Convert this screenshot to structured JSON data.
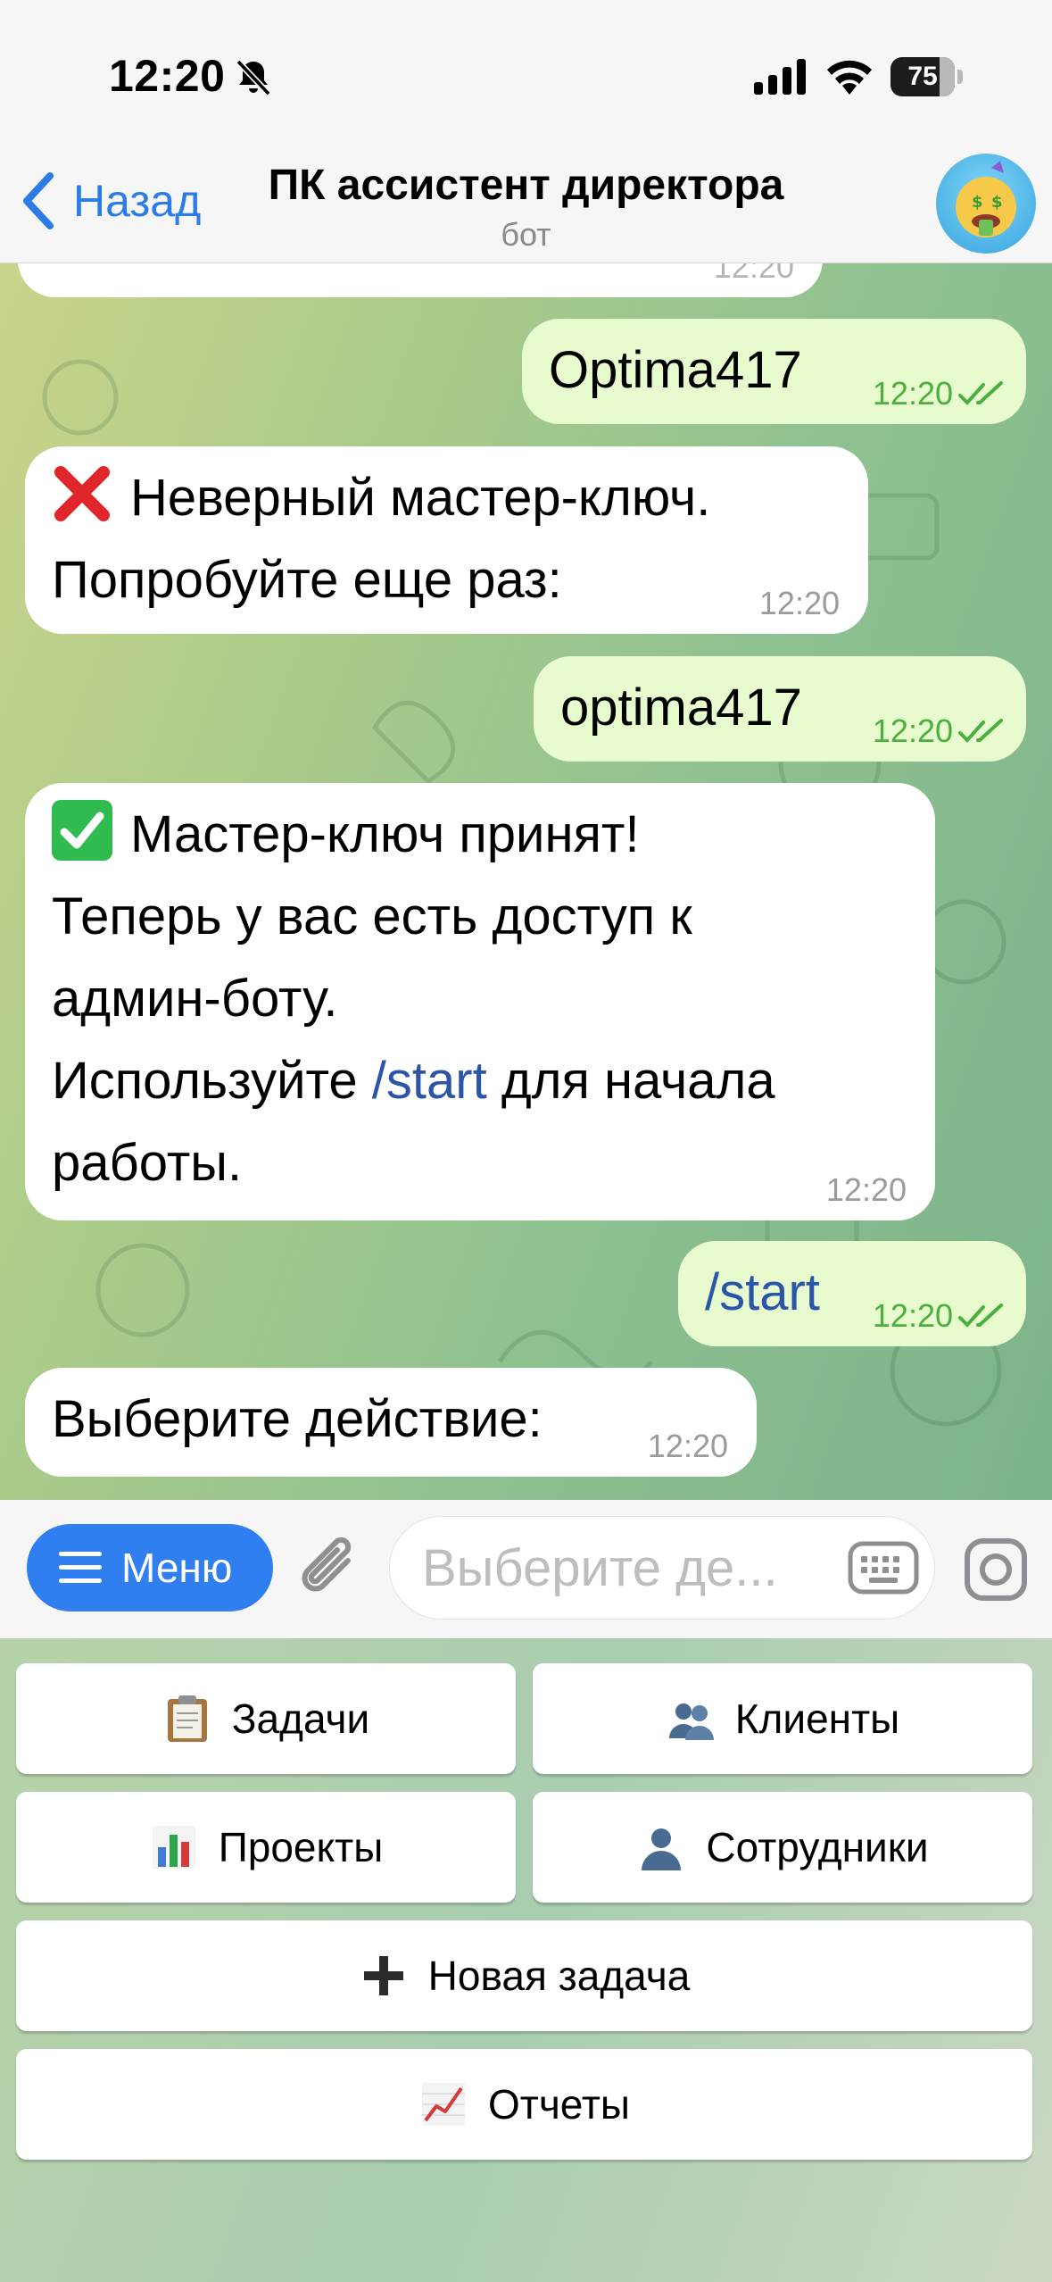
{
  "status_bar": {
    "time": "12:20",
    "battery": "75",
    "icons": [
      "bell-slash-icon",
      "cellular-signal-icon",
      "wifi-icon",
      "battery-icon"
    ]
  },
  "header": {
    "back_label": "Назад",
    "title": "ПК ассистент директора",
    "subtitle": "бот",
    "avatar_icon": "money-mouth-face-icon"
  },
  "chat": {
    "messages": [
      {
        "direction": "out",
        "text": "Optima417",
        "time": "12:20",
        "read": true
      },
      {
        "direction": "in",
        "icon": "red-cross-mark-icon",
        "lines": [
          "Неверный мастер-ключ.",
          "Попробуйте еще раз:"
        ],
        "time": "12:20"
      },
      {
        "direction": "out",
        "text": "optima417",
        "time": "12:20",
        "read": true
      },
      {
        "direction": "in",
        "icon": "green-check-mark-icon",
        "lines": [
          "Мастер-ключ принят!",
          "Теперь у вас есть доступ к",
          "админ-боту.",
          "Используйте",
          "/start",
          "для начала",
          "работы."
        ],
        "time": "12:20"
      },
      {
        "direction": "out",
        "text": "/start",
        "time": "12:20",
        "read": true
      },
      {
        "direction": "in",
        "text": "Выберите действие:",
        "time": "12:20"
      }
    ]
  },
  "input_bar": {
    "menu_label": "Меню",
    "placeholder": "Выберите де..."
  },
  "bot_keyboard": {
    "buttons": [
      {
        "label": "Задачи",
        "icon": "clipboard-icon"
      },
      {
        "label": "Клиенты",
        "icon": "busts-in-silhouette-icon"
      },
      {
        "label": "Проекты",
        "icon": "bar-chart-icon"
      },
      {
        "label": "Сотрудники",
        "icon": "bust-in-silhouette-icon"
      },
      {
        "label": "Новая задача",
        "icon": "plus-icon"
      },
      {
        "label": "Отчеты",
        "icon": "chart-increasing-icon"
      }
    ]
  },
  "colors": {
    "accent": "#2f7ff0",
    "outgoing_bubble": "#e7fbcf",
    "incoming_bubble": "#ffffff",
    "read_check": "#4caf3d",
    "link": "#2a55a8"
  }
}
